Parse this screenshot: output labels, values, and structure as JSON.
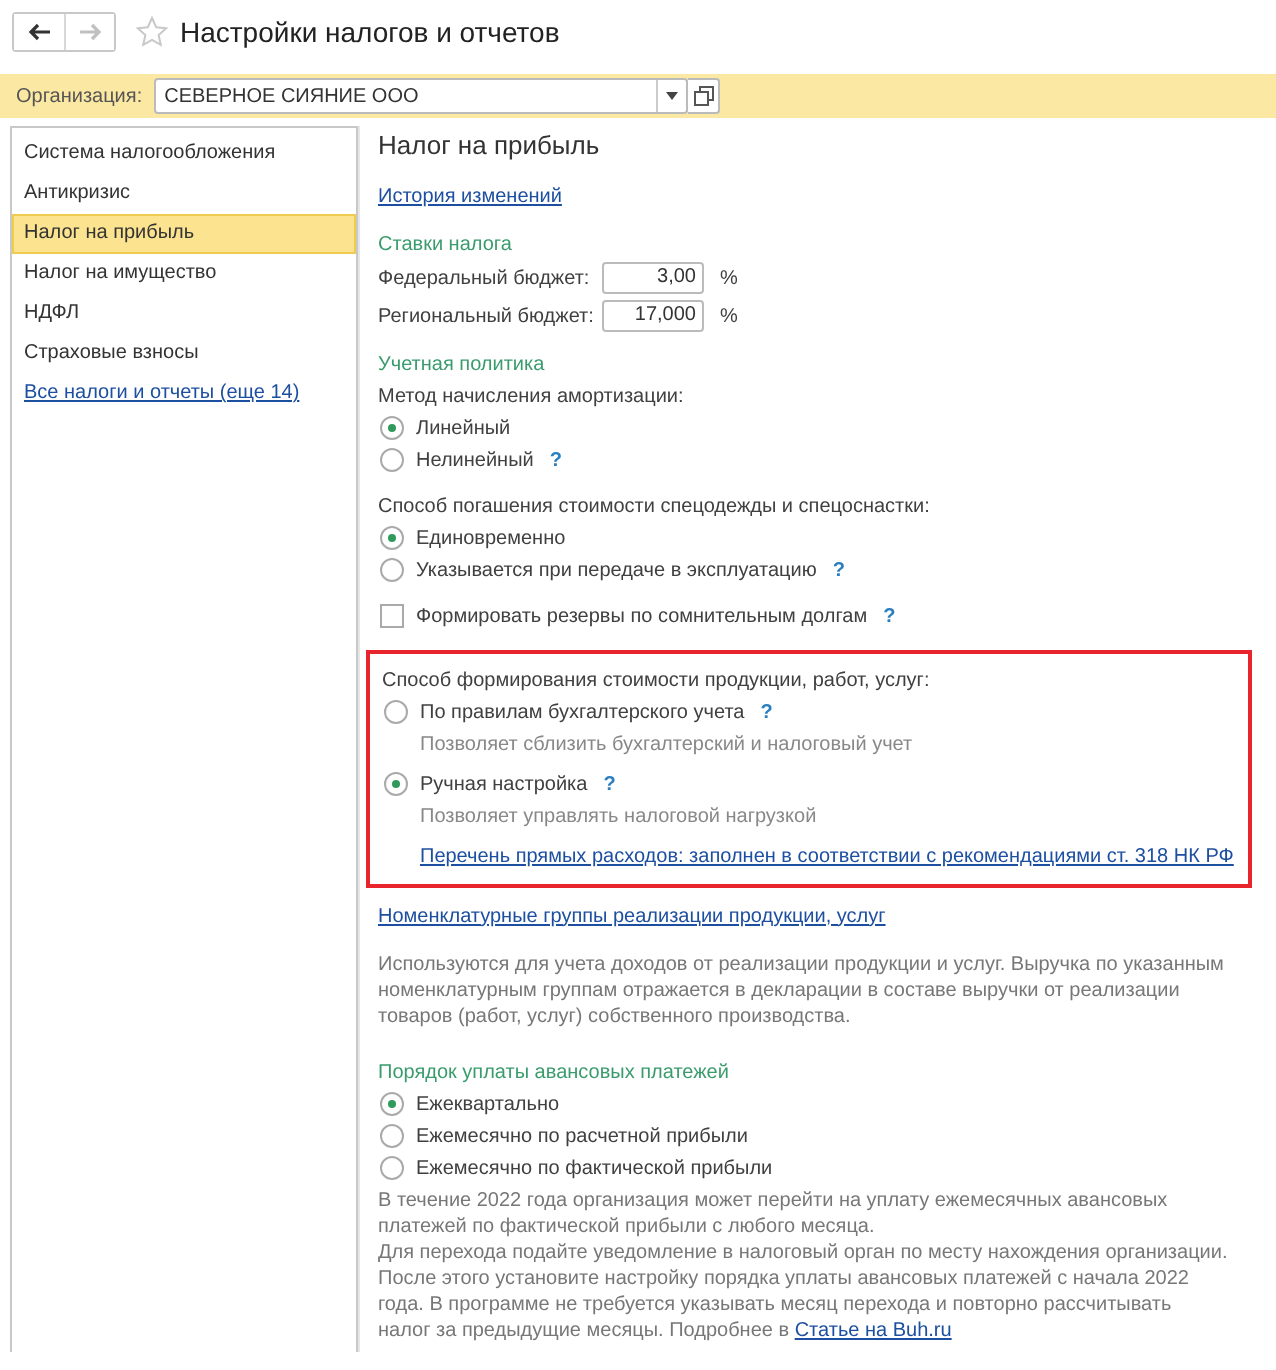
{
  "window": {
    "title": "Настройки налогов и отчетов",
    "back_enabled": true,
    "forward_enabled": false,
    "favorite": false
  },
  "organization": {
    "label": "Организация:",
    "value": "СЕВЕРНОЕ СИЯНИЕ ООО"
  },
  "sidebar": {
    "items": [
      {
        "label": "Система налогообложения",
        "kind": "item",
        "selected": false
      },
      {
        "label": "Антикризис",
        "kind": "item",
        "selected": false
      },
      {
        "label": "Налог на прибыль",
        "kind": "item",
        "selected": true
      },
      {
        "label": "Налог на имущество",
        "kind": "item",
        "selected": false
      },
      {
        "label": "НДФЛ",
        "kind": "item",
        "selected": false
      },
      {
        "label": "Страховые взносы",
        "kind": "item",
        "selected": false
      },
      {
        "label": "Все налоги и отчеты (еще 14)",
        "kind": "link",
        "selected": false
      }
    ]
  },
  "content": {
    "title": "Налог на прибыль",
    "items": [
      {
        "kind": "link",
        "text": "История изменений"
      },
      {
        "kind": "heading",
        "text": "Ставки налога"
      },
      {
        "kind": "field",
        "label": "Федеральный бюджет:",
        "value": "3,00",
        "unit": "%"
      },
      {
        "kind": "field",
        "label": "Региональный бюджет:",
        "value": "17,000",
        "unit": "%"
      },
      {
        "kind": "heading",
        "text": "Учетная политика"
      },
      {
        "kind": "label",
        "text": "Метод начисления амортизации:"
      },
      {
        "kind": "radio",
        "text": "Линейный",
        "selected": true
      },
      {
        "kind": "radio",
        "text": "Нелинейный",
        "selected": false,
        "help": "?"
      },
      {
        "kind": "label",
        "text": "Способ погашения стоимости спецодежды и спецоснастки:"
      },
      {
        "kind": "radio",
        "text": "Единовременно",
        "selected": true
      },
      {
        "kind": "radio",
        "text": "Указывается при передаче в эксплуатацию",
        "selected": false,
        "help": "?"
      },
      {
        "kind": "checkbox",
        "text": "Формировать резервы по сомнительным долгам",
        "checked": false,
        "help": "?"
      },
      {
        "kind": "highlight",
        "children": [
          {
            "kind": "label",
            "text": "Способ формирования стоимости продукции, работ, услуг:"
          },
          {
            "kind": "radio",
            "text": "По правилам бухгалтерского учета",
            "selected": false,
            "help": "?"
          },
          {
            "kind": "hint",
            "text": "Позволяет сблизить бухгалтерский и налоговый учет"
          },
          {
            "kind": "radio",
            "text": "Ручная настройка",
            "selected": true,
            "help": "?"
          },
          {
            "kind": "hint",
            "text": "Позволяет управлять налоговой нагрузкой"
          },
          {
            "kind": "sublink",
            "text": "Перечень прямых расходов: заполнен в соответствии с рекомендациями ст. 318 НК РФ"
          }
        ]
      },
      {
        "kind": "link",
        "text": "Номенклатурные группы реализации продукции, услуг"
      },
      {
        "kind": "note",
        "text": "Используются для учета доходов от реализации продукции и услуг. Выручка по указанным номенклатурным группам отражается в декларации в составе выручки от реализации товаров (работ, услуг) собственного производства."
      },
      {
        "kind": "heading",
        "text": "Порядок уплаты авансовых платежей"
      },
      {
        "kind": "radio",
        "text": "Ежеквартально",
        "selected": true
      },
      {
        "kind": "radio",
        "text": "Ежемесячно по расчетной прибыли",
        "selected": false
      },
      {
        "kind": "radio",
        "text": "Ежемесячно по фактической прибыли",
        "selected": false
      },
      {
        "kind": "note",
        "text": "В течение 2022 года организация может перейти на уплату ежемесячных авансовых платежей по фактической прибыли с любого месяца.\nДля перехода подайте уведомление в налоговый орган по месту нахождения организации. После этого установите настройку порядка уплаты авансовых платежей с начала 2022 года. В программе не требуется указывать месяц перехода и повторно рассчитывать налог за предыдущие месяцы. Подробнее в ",
        "link": "Статье на Buh.ru"
      }
    ]
  }
}
